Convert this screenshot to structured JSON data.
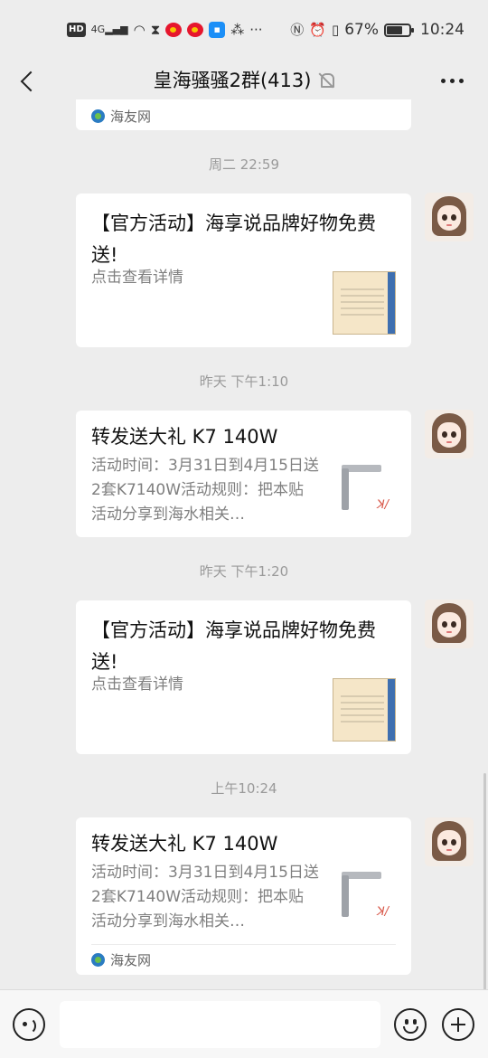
{
  "status_bar": {
    "network_badge": "HD",
    "network_type": "4G",
    "battery": "67%",
    "time": "10:24",
    "icons": [
      "hd-icon",
      "signal-icon",
      "wifi-icon",
      "hourglass-icon",
      "weibo-icon",
      "weibo-icon",
      "truck-app-icon",
      "translate-icon",
      "more-dots-icon",
      "nfc-icon",
      "alarm-icon",
      "vibrate-icon",
      "battery-icon"
    ]
  },
  "header": {
    "title": "皇海骚骚2群(413)",
    "muted": true
  },
  "messages": [
    {
      "type": "source_fragment",
      "source": "海友网"
    },
    {
      "type": "timestamp",
      "text": "周二 22:59"
    },
    {
      "type": "card",
      "title": "【官方活动】海享说品牌好物免费送!",
      "desc": "点击查看详情",
      "thumb": "document"
    },
    {
      "type": "timestamp",
      "text": "昨天 下午1:10"
    },
    {
      "type": "card",
      "title": "转发送大礼 K7 140W",
      "desc": "活动时间：3月31日到4月15日送2套K7140W活动规则：把本贴活动分享到海水相关…",
      "thumb": "lamp"
    },
    {
      "type": "timestamp",
      "text": "昨天 下午1:20"
    },
    {
      "type": "card",
      "title": "【官方活动】海享说品牌好物免费送!",
      "desc": "点击查看详情",
      "thumb": "document"
    },
    {
      "type": "timestamp",
      "text": "上午10:24"
    },
    {
      "type": "card",
      "title": "转发送大礼 K7 140W",
      "desc": "活动时间：3月31日到4月15日送2套K7140W活动规则：把本贴活动分享到海水相关…",
      "thumb": "lamp",
      "source": "海友网"
    }
  ],
  "colors": {
    "background": "#ededed",
    "card": "#ffffff",
    "timestamp": "#9a9a9a"
  }
}
